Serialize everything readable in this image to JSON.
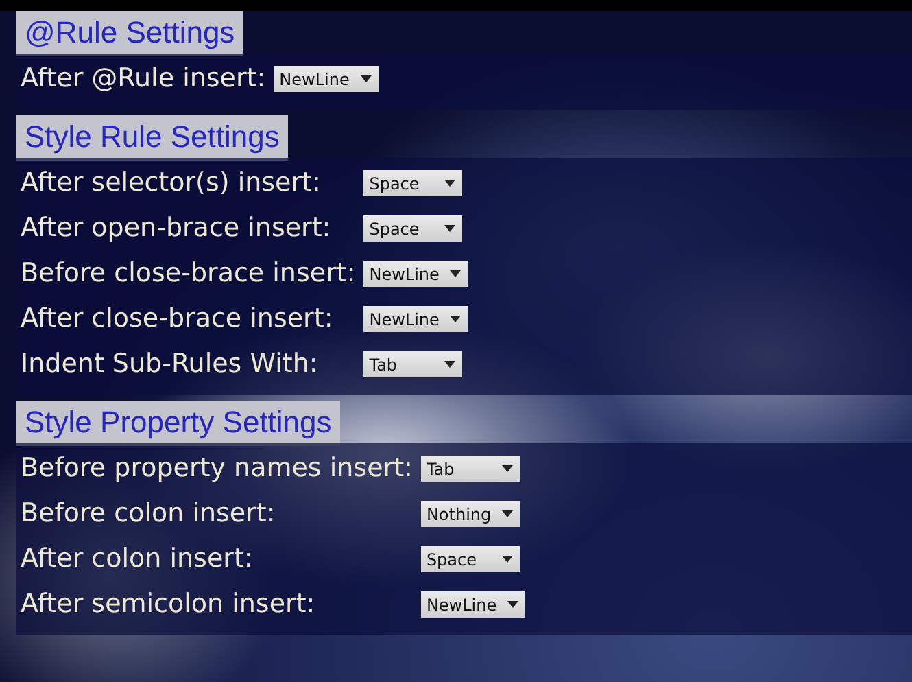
{
  "sections": [
    {
      "title": "@Rule Settings",
      "rows": [
        {
          "label": "After @Rule insert:",
          "value": "NewLine"
        }
      ]
    },
    {
      "title": "Style Rule Settings",
      "rows": [
        {
          "label": "After selector(s) insert:",
          "value": "Space"
        },
        {
          "label": "After open-brace insert:",
          "value": "Space"
        },
        {
          "label": "Before close-brace insert:",
          "value": "NewLine"
        },
        {
          "label": "After close-brace insert:",
          "value": "NewLine"
        },
        {
          "label": "Indent Sub-Rules With:",
          "value": "Tab"
        }
      ]
    },
    {
      "title": "Style Property Settings",
      "rows": [
        {
          "label": "Before property names insert:",
          "value": "Tab"
        },
        {
          "label": "Before colon insert:",
          "value": "Nothing"
        },
        {
          "label": "After colon insert:",
          "value": "Space"
        },
        {
          "label": "After semicolon insert:",
          "value": "NewLine"
        }
      ]
    }
  ]
}
